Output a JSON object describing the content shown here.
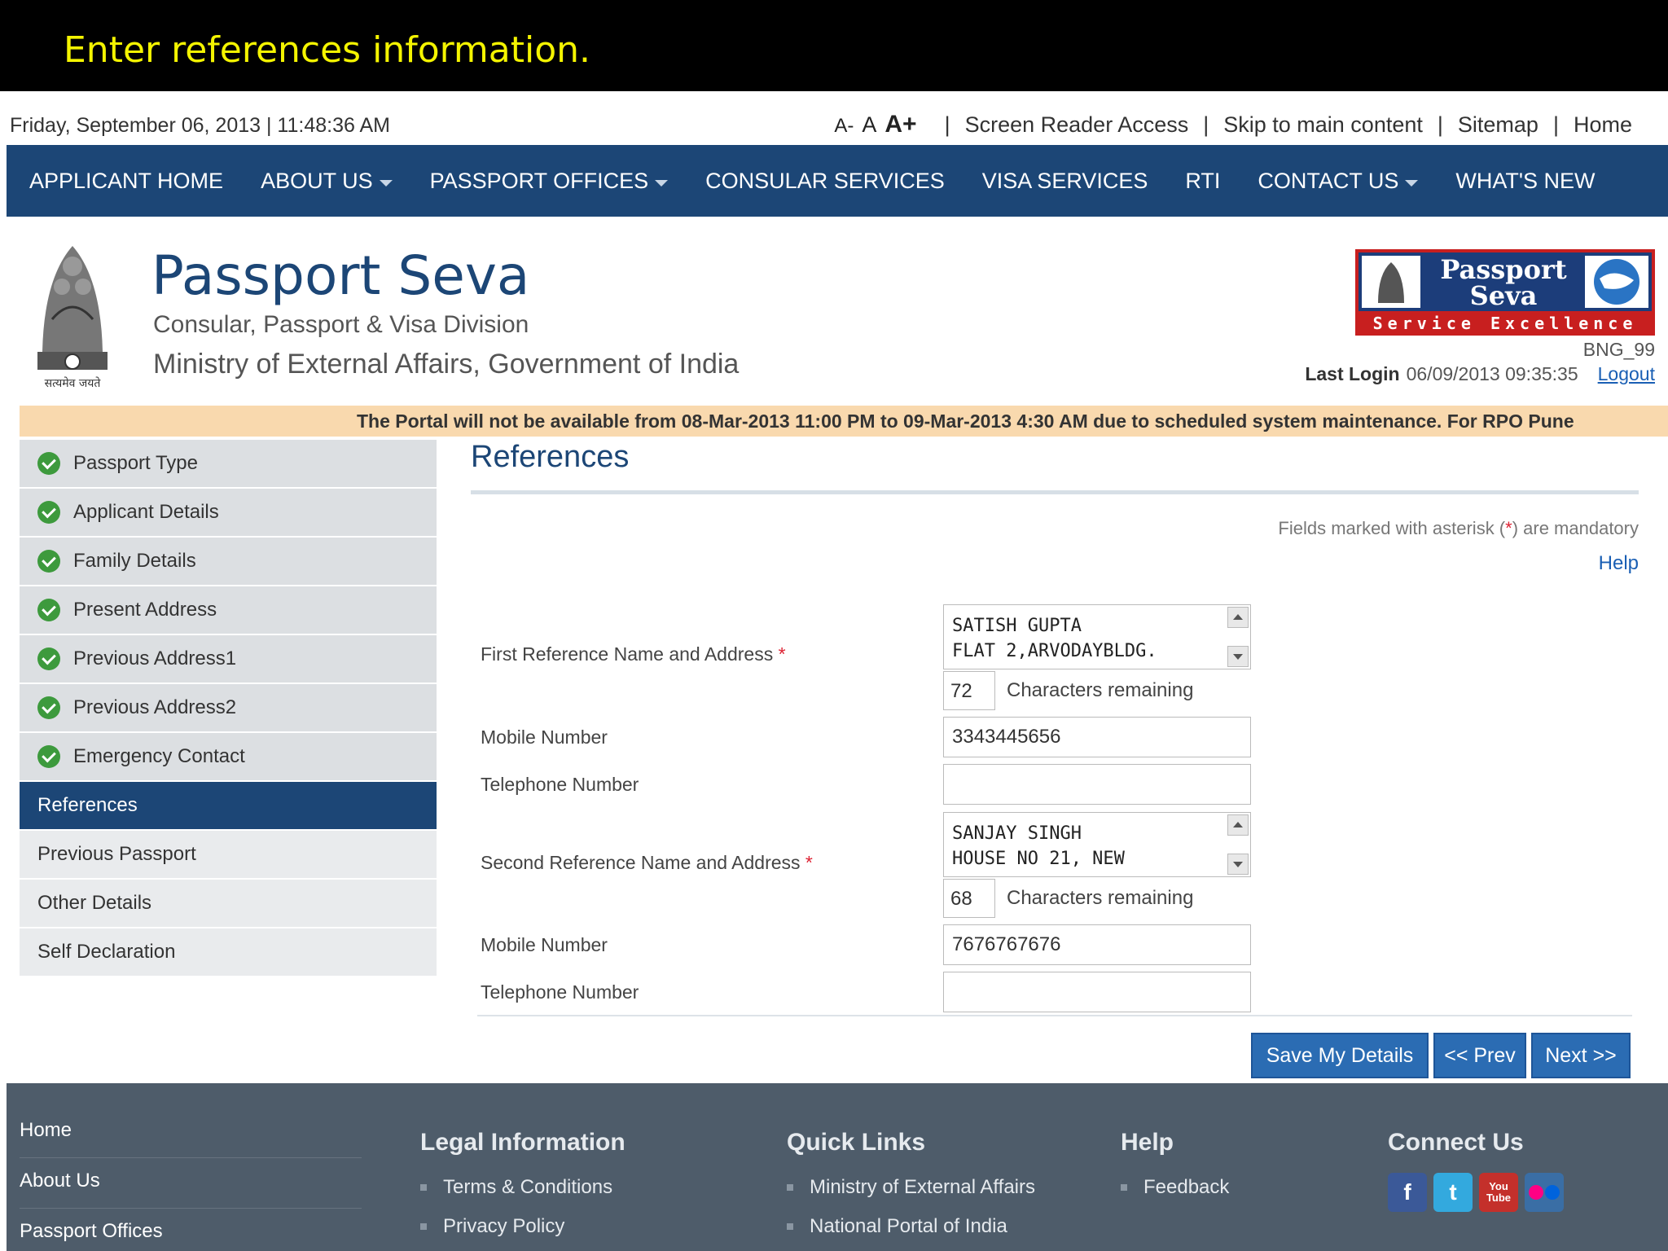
{
  "banner": {
    "text": "Enter references information."
  },
  "topbar": {
    "datetime": "Friday,  September  06, 2013 | 11:48:36 AM",
    "font_small": "A-",
    "font_normal": "A",
    "font_large": "A+",
    "links": [
      "Screen Reader Access",
      "Skip to main content",
      "Sitemap",
      "Home"
    ]
  },
  "nav": {
    "items": [
      {
        "label": "APPLICANT HOME"
      },
      {
        "label": "ABOUT US"
      },
      {
        "label": "PASSPORT OFFICES"
      },
      {
        "label": "CONSULAR SERVICES"
      },
      {
        "label": "VISA SERVICES"
      },
      {
        "label": "RTI"
      },
      {
        "label": "CONTACT US"
      },
      {
        "label": "WHAT'S NEW"
      }
    ]
  },
  "header": {
    "title": "Passport Seva",
    "subtitle1": "Consular, Passport & Visa Division",
    "subtitle2": "Ministry of External Affairs, Government of India",
    "emblem_motto": "सत्यमेव जयते",
    "logo_line1": "Passport",
    "logo_line2": "Seva",
    "logo_tagline": "Service Excellence",
    "user_id": "BNG_99",
    "last_login_label": "Last Login",
    "last_login_value": "06/09/2013 09:35:35",
    "logout": "Logout"
  },
  "notice": "The Portal will not be available from 08-Mar-2013 11:00 PM to 09-Mar-2013 4:30 AM due to scheduled system maintenance. For RPO Pune",
  "sidebar": {
    "items": [
      {
        "label": "Passport Type",
        "status": "done"
      },
      {
        "label": "Applicant Details",
        "status": "done"
      },
      {
        "label": "Family Details",
        "status": "done"
      },
      {
        "label": "Present Address",
        "status": "done"
      },
      {
        "label": "Previous Address1",
        "status": "done"
      },
      {
        "label": "Previous Address2",
        "status": "done"
      },
      {
        "label": "Emergency Contact",
        "status": "done"
      },
      {
        "label": "References",
        "status": "active"
      },
      {
        "label": "Previous Passport",
        "status": "pending"
      },
      {
        "label": "Other Details",
        "status": "pending"
      },
      {
        "label": "Self Declaration",
        "status": "pending"
      }
    ]
  },
  "main": {
    "title": "References",
    "mandatory_note_pre": "Fields marked with asterisk (",
    "mandatory_note_ast": "*",
    "mandatory_note_post": ") are mandatory",
    "help": "Help",
    "first_ref": {
      "label": "First Reference Name and Address",
      "value": "SATISH GUPTA\nFLAT 2,ARVODAYBLDG.",
      "chars_remaining": "72",
      "chars_label": "Characters remaining",
      "mobile_label": "Mobile Number",
      "mobile_value": "3343445656",
      "telephone_label": "Telephone Number",
      "telephone_value": ""
    },
    "second_ref": {
      "label": "Second Reference Name and Address",
      "value": "SANJAY SINGH\nHOUSE NO 21, NEW",
      "chars_remaining": "68",
      "chars_label": "Characters remaining",
      "mobile_label": "Mobile Number",
      "mobile_value": "7676767676",
      "telephone_label": "Telephone Number",
      "telephone_value": ""
    },
    "required_mark": "*",
    "buttons": {
      "save": "Save My Details",
      "prev": "<< Prev",
      "next": "Next >>"
    }
  },
  "footer": {
    "links": [
      "Home",
      "About Us",
      "Passport Offices"
    ],
    "legal": {
      "heading": "Legal Information",
      "items": [
        "Terms & Conditions",
        "Privacy Policy"
      ]
    },
    "quick": {
      "heading": "Quick Links",
      "items": [
        "Ministry of External Affairs",
        "National Portal of India"
      ]
    },
    "help": {
      "heading": "Help",
      "items": [
        "Feedback"
      ]
    },
    "connect": {
      "heading": "Connect Us"
    },
    "social": [
      {
        "icon": "facebook-icon",
        "glyph": "f",
        "color": "#3b5998"
      },
      {
        "icon": "twitter-icon",
        "glyph": "t",
        "color": "#33a9de"
      },
      {
        "icon": "youtube-icon",
        "glyph": "You Tube",
        "color": "#c4302b"
      },
      {
        "icon": "flickr-icon",
        "glyph": "",
        "color": "#3a6ea5"
      }
    ]
  }
}
